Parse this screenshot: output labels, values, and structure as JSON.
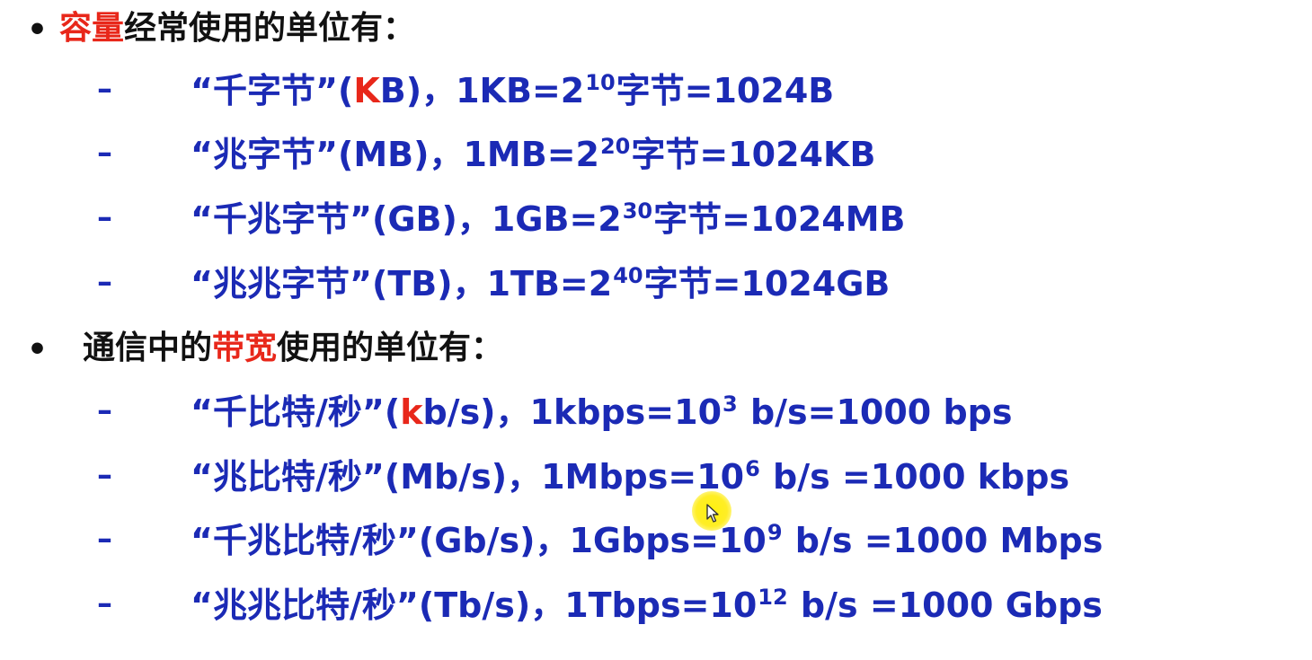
{
  "bullets": [
    {
      "marker": "•",
      "prefix": "",
      "highlight": "容量",
      "suffix": "经常使用的单位有：",
      "items": [
        {
          "dash": "–",
          "name": "“千字节”(",
          "unit_red": "K",
          "unit_rest": "B)，1KB=2",
          "exp": "10",
          "tail": "字节=1024B"
        },
        {
          "dash": "–",
          "name": "“兆字节”(",
          "unit_red": "",
          "unit_rest": "MB)，1MB=2",
          "exp": "20",
          "tail": "字节=1024KB"
        },
        {
          "dash": "–",
          "name": "“千兆字节”(",
          "unit_red": "",
          "unit_rest": "GB)，1GB=2",
          "exp": "30",
          "tail": "字节=1024MB"
        },
        {
          "dash": "–",
          "name": "“兆兆字节”(",
          "unit_red": "",
          "unit_rest": "TB)，1TB=2",
          "exp": "40",
          "tail": "字节=1024GB"
        }
      ]
    },
    {
      "marker": "•",
      "prefix": "通信中的",
      "highlight": "带宽",
      "suffix": "使用的单位有：",
      "items": [
        {
          "dash": "–",
          "name": "“千比特/秒”(",
          "unit_red": "k",
          "unit_rest": "b/s)，1kbps=10",
          "exp": "3",
          "tail": " b/s=1000 bps"
        },
        {
          "dash": "–",
          "name": "“兆比特/秒”(",
          "unit_red": "",
          "unit_rest": "Mb/s)，1Mbps=10",
          "exp": "6",
          "tail": " b/s =1000 kbps"
        },
        {
          "dash": "–",
          "name": "“千兆比特/秒”(",
          "unit_red": "",
          "unit_rest": "Gb/s)，1Gbps=10",
          "exp": "9",
          "tail": " b/s =1000 Mbps"
        },
        {
          "dash": "–",
          "name": "“兆兆比特/秒”(",
          "unit_red": "",
          "unit_rest": "Tb/s)，1Tbps=10",
          "exp": "12",
          "tail": " b/s =1000 Gbps"
        }
      ]
    }
  ],
  "colors": {
    "body_text": "#111111",
    "highlight": "#e8271a",
    "item_text": "#1b2ab5",
    "cursor_halo": "#fff000"
  },
  "icons": {
    "cursor": "mouse-pointer-icon"
  }
}
